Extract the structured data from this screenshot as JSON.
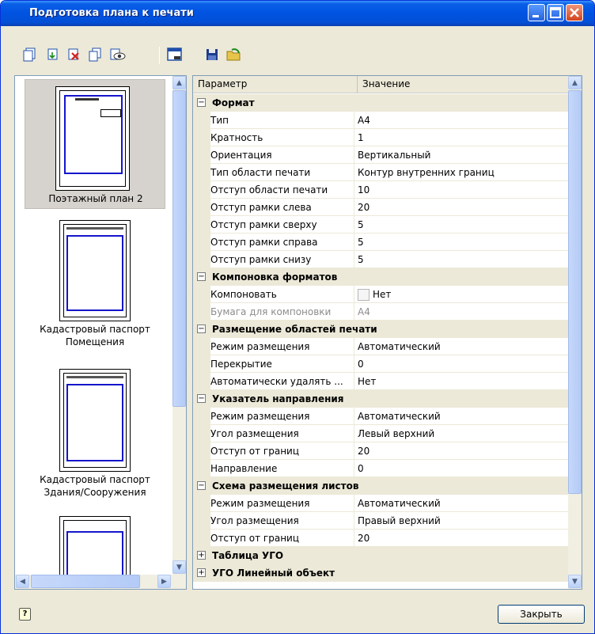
{
  "window": {
    "title": "Подготовка плана к печати"
  },
  "toolbar": {
    "icons": [
      "add-sheet-icon",
      "insert-sheet-icon",
      "delete-sheet-icon",
      "copy-sheet-icon",
      "preview-icon",
      "page-setup-icon",
      "save-icon",
      "open-icon"
    ]
  },
  "thumbnails": [
    {
      "label": "Поэтажный план 2"
    },
    {
      "label": "Кадастровый паспорт Помещения"
    },
    {
      "label": "Кадастровый паспорт Здания/Сооружения"
    }
  ],
  "grid": {
    "header": {
      "param": "Параметр",
      "value": "Значение"
    },
    "sections": [
      {
        "title": "Формат",
        "expanded": true,
        "rows": [
          {
            "param": "Тип",
            "value": "A4"
          },
          {
            "param": "Кратность",
            "value": "1"
          },
          {
            "param": "Ориентация",
            "value": "Вертикальный"
          },
          {
            "param": "Тип области печати",
            "value": "Контур внутренних границ"
          },
          {
            "param": "Отступ области печати",
            "value": "10"
          },
          {
            "param": "Отступ рамки слева",
            "value": "20"
          },
          {
            "param": "Отступ рамки сверху",
            "value": "5"
          },
          {
            "param": "Отступ рамки справа",
            "value": "5"
          },
          {
            "param": "Отступ рамки снизу",
            "value": "5"
          }
        ]
      },
      {
        "title": "Компоновка форматов",
        "expanded": true,
        "rows": [
          {
            "param": "Компоновать",
            "value": "Нет"
          },
          {
            "param": "Бумага для компоновки",
            "value": "A4"
          }
        ]
      },
      {
        "title": "Размещение областей печати",
        "expanded": true,
        "rows": [
          {
            "param": "Режим размещения",
            "value": "Автоматический"
          },
          {
            "param": "Перекрытие",
            "value": "0"
          },
          {
            "param": "Автоматически удалять ...",
            "value": "Нет"
          }
        ]
      },
      {
        "title": "Указатель направления",
        "expanded": true,
        "rows": [
          {
            "param": "Режим размещения",
            "value": "Автоматический"
          },
          {
            "param": "Угол размещения",
            "value": "Левый верхний"
          },
          {
            "param": "Отступ от границ",
            "value": "20"
          },
          {
            "param": "Направление",
            "value": "0"
          }
        ]
      },
      {
        "title": "Схема размещения листов",
        "expanded": true,
        "rows": [
          {
            "param": "Режим размещения",
            "value": "Автоматический"
          },
          {
            "param": "Угол размещения",
            "value": "Правый верхний"
          },
          {
            "param": "Отступ от границ",
            "value": "20"
          }
        ]
      },
      {
        "title": "Таблица УГО",
        "expanded": false,
        "rows": []
      },
      {
        "title": "УГО Линейный объект",
        "expanded": false,
        "rows": []
      }
    ]
  },
  "buttons": {
    "close": "Закрыть"
  },
  "colors": {
    "titlebar": "#0053e1",
    "window_bg": "#ece9d8",
    "border": "#7f9db9"
  }
}
